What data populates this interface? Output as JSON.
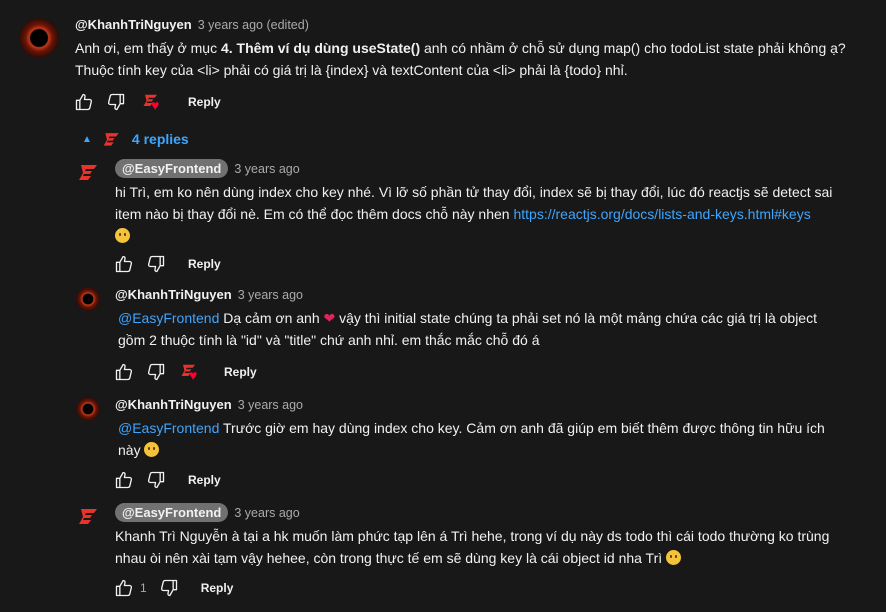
{
  "comment": {
    "author": "@KhanhTriNguyen",
    "time": "3 years ago (edited)",
    "line1_a": "Anh ơi, em thấy ở mục ",
    "line1_bold": "4. Thêm ví dụ dùng useState()",
    "line1_b": " anh có nhầm ở chỗ sử dụng map() cho todoList state phải không ạ?",
    "line2": "Thuộc tính key của <li> phải có giá trị là {index} và textContent của <li> phải là {todo} nhỉ.",
    "reply_label": "Reply"
  },
  "replies_toggle": {
    "label": "4 replies"
  },
  "replies": [
    {
      "author": "@EasyFrontend",
      "time": "3 years ago",
      "line1": "hi Trì, em ko nên dùng index cho key nhé. Vì lỡ số phần tử thay đổi, index sẽ bị thay đổi, lúc đó reactjs sẽ detect sai",
      "line2": "item nào bị thay đổi nè. Em có thể đọc thêm docs chỗ này nhen ",
      "link": "https://reactjs.org/docs/lists-and-keys.html#keys",
      "reply_label": "Reply"
    },
    {
      "author": "@KhanhTriNguyen",
      "time": "3 years ago",
      "mention": "@EasyFrontend",
      "line1": " Dạ cảm ơn anh ",
      "line1_b": " vậy thì initial state chúng ta phải set nó là một mảng chứa các giá trị là object",
      "line2": "gồm 2 thuộc tính là \"id\" và \"title\" chứ anh nhỉ. em thắc mắc chỗ đó á",
      "reply_label": "Reply"
    },
    {
      "author": "@KhanhTriNguyen",
      "time": "3 years ago",
      "mention": "@EasyFrontend",
      "line1": " Trước giờ em hay dùng index cho key. Cảm ơn anh đã giúp em biết thêm được thông tin hữu ích",
      "line2": "này ",
      "reply_label": "Reply"
    },
    {
      "author": "@EasyFrontend",
      "time": "3 years ago",
      "line1": "Khanh Trì Nguyễn à tại a hk muốn làm phức tạp lên á Trì hehe, trong ví dụ này ds todo thì cái todo thường ko trùng",
      "line2": "nhau òi nên xài tạm vậy hehee, còn trong thực tế em sẽ dùng key là cái object id nha Trì ",
      "like_count": "1",
      "reply_label": "Reply"
    }
  ]
}
